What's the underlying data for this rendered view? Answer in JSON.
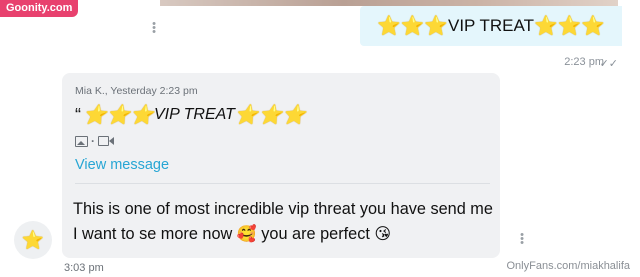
{
  "watermark_top": "Goonity.com",
  "watermark_bottom": "OnlyFans.com/miakhalifa",
  "sent_message": {
    "text": "VIP TREAT",
    "leading_stars": "⭐⭐⭐",
    "trailing_stars": "⭐⭐⭐",
    "time": "2:23 pm",
    "status_icon": "double-check-icon"
  },
  "received_message": {
    "quote_meta": "Mia K., Yesterday 2:23 pm",
    "quote_mark": "“",
    "quote_text": "VIP TREAT",
    "quote_leading_stars": "⭐⭐⭐",
    "quote_trailing_stars": "⭐⭐⭐",
    "media_icons": [
      "image-icon",
      "video-icon"
    ],
    "view_link": "View message",
    "body_part1": "This is one of most incredible vip threat you have send me I want to se more now",
    "emoji1": "🥰",
    "body_part2": "you are perfect",
    "emoji2": "😘",
    "time": "3:03 pm"
  },
  "avatar_icon": "⭐",
  "colors": {
    "sent_bubble": "#e4f6fc",
    "received_bubble": "#f0f1f3",
    "link": "#27a6d4",
    "watermark_badge": "#e8416e"
  }
}
